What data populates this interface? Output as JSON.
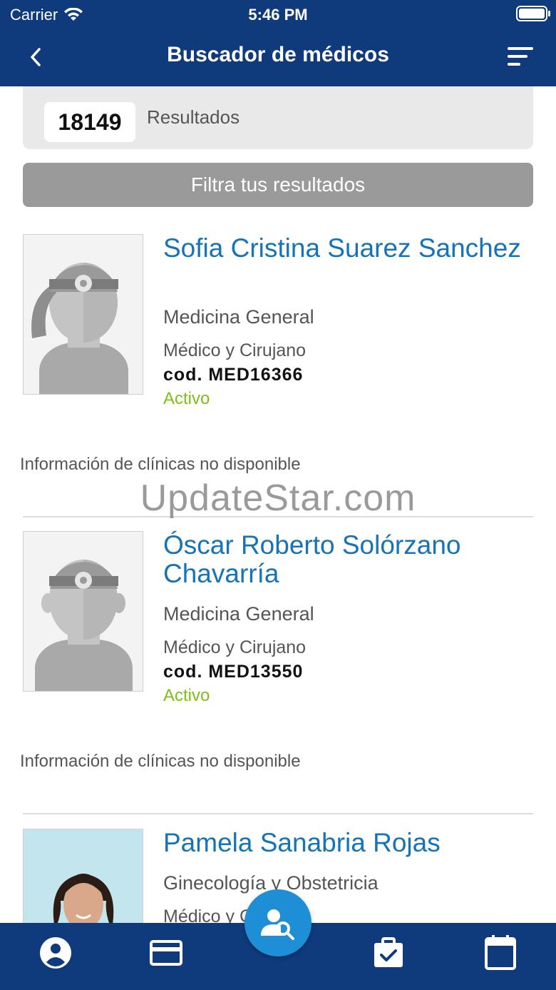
{
  "status_bar": {
    "carrier": "Carrier",
    "time": "5:46 PM"
  },
  "header": {
    "title": "Buscador de médicos",
    "back_icon": "chevron-left-icon",
    "sort_icon": "sort-lines-icon"
  },
  "results": {
    "count": "18149",
    "label": "Resultados"
  },
  "filter": {
    "label": "Filtra tus resultados"
  },
  "doctors": [
    {
      "name": "Sofia Cristina Suarez Sanchez",
      "specialty": "Medicina General",
      "profession": "Médico y Cirujano",
      "code": "cod. MED16366",
      "status": "Activo",
      "clinic_info": "Información de clínicas no disponible",
      "photo": "female-doctor-placeholder"
    },
    {
      "name": "Óscar Roberto Solórzano Chavarría",
      "specialty": "Medicina General",
      "profession": "Médico y Cirujano",
      "code": "cod. MED13550",
      "status": "Activo",
      "clinic_info": "Información de clínicas no disponible",
      "photo": "male-doctor-placeholder"
    },
    {
      "name": "Pamela Sanabria Rojas",
      "specialty": "Ginecología y Obstetricia",
      "profession": "Médico y Cirujano",
      "photo": "doctor-photo"
    }
  ],
  "watermark": "UpdateStar.com",
  "tabbar": {
    "items": [
      "profile-icon",
      "card-icon",
      "doctor-search-icon",
      "clipboard-check-icon",
      "calendar-icon"
    ]
  },
  "colors": {
    "brand": "#0f3a7c",
    "link": "#1673b8",
    "active": "#7cc214",
    "fab": "#1e8fd6"
  }
}
